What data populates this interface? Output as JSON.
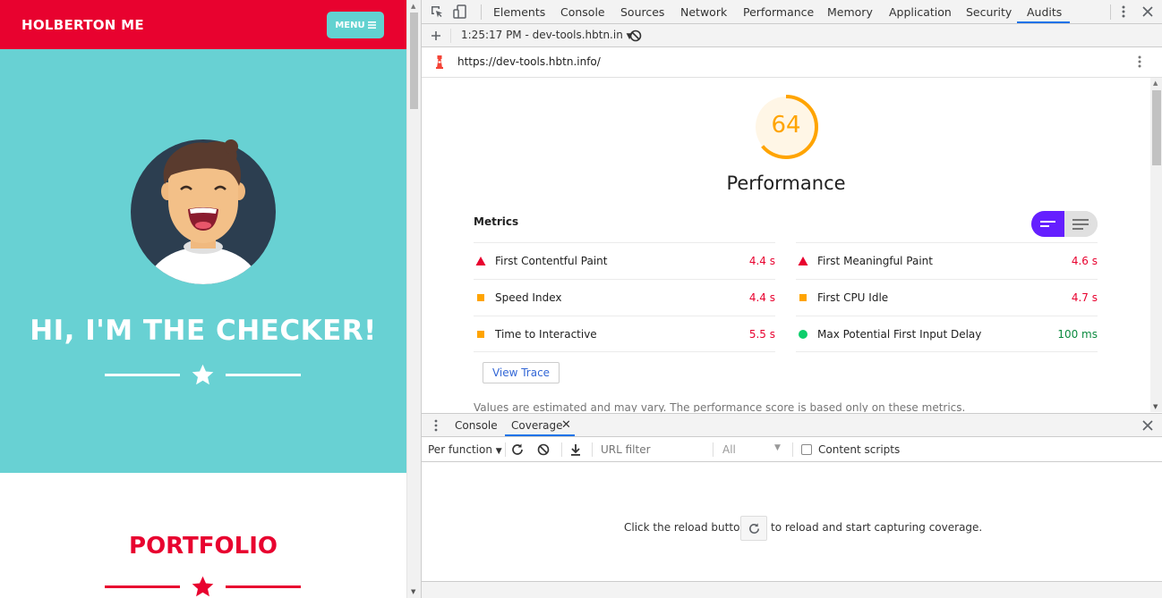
{
  "site": {
    "brand": "HOLBERTON ME",
    "menu_label": "MENU",
    "hero_title": "HI, I'M THE CHECKER!",
    "portfolio_title": "PORTFOLIO",
    "colors": {
      "header": "#e8022f",
      "hero": "#68d1d3",
      "accent": "#e8022f"
    }
  },
  "devtools": {
    "tabs": [
      "Elements",
      "Console",
      "Sources",
      "Network",
      "Performance",
      "Memory",
      "Application",
      "Security",
      "Audits"
    ],
    "active_tab": "Audits",
    "report_select": "1:25:17 PM - dev-tools.hbtn.in",
    "url": "https://dev-tools.hbtn.info/",
    "audit": {
      "score": "64",
      "score_fraction": 0.64,
      "score_color": "#ffa400",
      "category": "Performance",
      "metrics_title": "Metrics",
      "metrics_left": [
        {
          "icon": "fail-triangle-icon",
          "label": "First Contentful Paint",
          "value": "4.4 s",
          "color": "#e8022f"
        },
        {
          "icon": "average-square-icon",
          "label": "Speed Index",
          "value": "4.4 s",
          "color": "#e8022f"
        },
        {
          "icon": "average-square-icon",
          "label": "Time to Interactive",
          "value": "5.5 s",
          "color": "#e8022f"
        }
      ],
      "metrics_right": [
        {
          "icon": "fail-triangle-icon",
          "label": "First Meaningful Paint",
          "value": "4.6 s",
          "color": "#e8022f"
        },
        {
          "icon": "average-square-icon",
          "label": "First CPU Idle",
          "value": "4.7 s",
          "color": "#e8022f"
        },
        {
          "icon": "pass-circle-icon",
          "label": "Max Potential First Input Delay",
          "value": "100 ms",
          "color": "#0b8a3f"
        }
      ],
      "view_trace": "View Trace",
      "disclaimer": "Values are estimated and may vary. The performance score is based only on these metrics."
    },
    "drawer": {
      "tabs": [
        "Console",
        "Coverage"
      ],
      "active_tab": "Coverage",
      "per_function": "Per function",
      "url_filter_placeholder": "URL filter",
      "all_select": "All",
      "content_scripts": "Content scripts",
      "message_before": "Click the reload button",
      "message_after": "to reload and start capturing coverage."
    }
  }
}
